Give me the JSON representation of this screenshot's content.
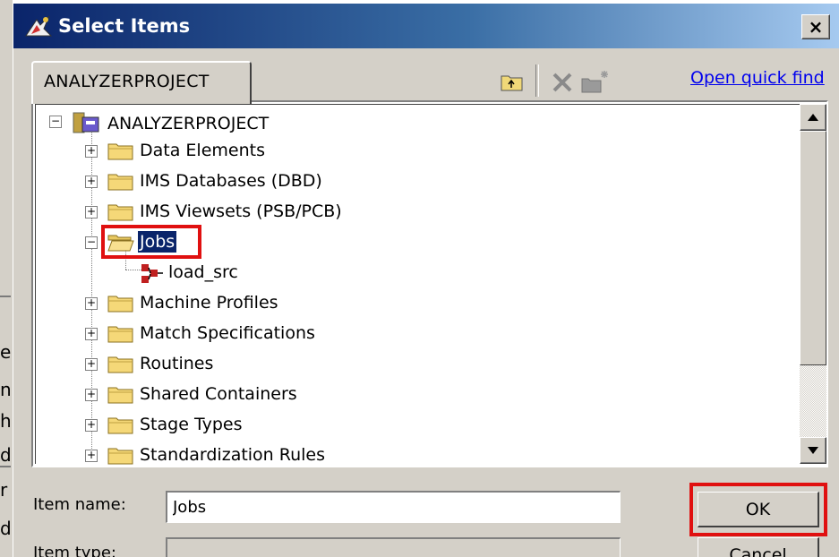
{
  "background_app": {
    "fragments": [
      "e",
      "n",
      "h",
      "d",
      "r",
      "d"
    ]
  },
  "dialog": {
    "title": "Select Items",
    "title_icon": "select-items-icon",
    "close_label": "×",
    "tab_label": "ANALYZERPROJECT",
    "toolbar": {
      "icons": [
        "folder-up-icon",
        "delete-icon",
        "new-folder-icon"
      ],
      "quick_find_label": "Open quick find"
    },
    "tree": {
      "root": "ANALYZERPROJECT",
      "items": [
        {
          "label": "Data Elements",
          "expander": "+"
        },
        {
          "label": "IMS Databases (DBD)",
          "expander": "+"
        },
        {
          "label": "IMS Viewsets (PSB/PCB)",
          "expander": "+"
        },
        {
          "label": "Jobs",
          "expander": "−",
          "selected": true
        },
        {
          "label": "load_src",
          "child": true
        },
        {
          "label": "Machine Profiles",
          "expander": "+"
        },
        {
          "label": "Match Specifications",
          "expander": "+"
        },
        {
          "label": "Routines",
          "expander": "+"
        },
        {
          "label": "Shared Containers",
          "expander": "+"
        },
        {
          "label": "Stage Types",
          "expander": "+"
        },
        {
          "label": "Standardization Rules",
          "expander": "+"
        }
      ],
      "root_expander": "−"
    },
    "scroll_up": "▲",
    "scroll_down": "▼",
    "form": {
      "item_name_label": "Item name:",
      "item_name_value": "Jobs",
      "item_type_label": "Item type:",
      "item_type_value": ""
    },
    "buttons": {
      "ok": "OK",
      "cancel": "Cancel"
    },
    "colors": {
      "title_gradient_start": "#0a246a",
      "title_gradient_end": "#a6caf0",
      "highlight_red": "#e01010",
      "selection_bg": "#0a246a",
      "link": "#0000ee",
      "face": "#d4d0c8"
    }
  }
}
